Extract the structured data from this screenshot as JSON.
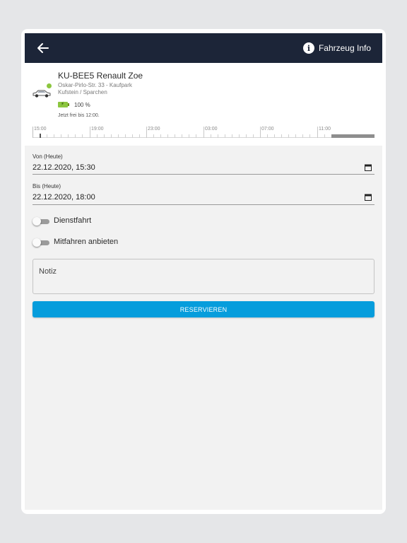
{
  "colors": {
    "appbar": "#1c2538",
    "accent": "#069ddc",
    "status_available": "#8cc63f",
    "battery": "#8cc63f"
  },
  "header": {
    "back_icon": "arrow-left-icon",
    "info_icon": "info-icon",
    "info_label": "Fahrzeug Info"
  },
  "vehicle": {
    "title": "KU-BEE5 Renault Zoe",
    "address_line1": "Oskar-Pirlo-Str. 33 - Kaufpark",
    "address_line2": "Kufstein / Sparchen",
    "battery_percent": "100 %",
    "availability": "Jetzt frei bis 12:00.",
    "car_icon": "car-icon"
  },
  "timeline": {
    "labels": [
      "15:00",
      "19:00",
      "23:00",
      "03:00",
      "07:00",
      "11:00"
    ]
  },
  "form": {
    "from_label": "Von (Heute)",
    "from_value": "22.12.2020, 15:30",
    "to_label": "Bis (Heute)",
    "to_value": "22.12.2020, 18:00",
    "calendar_icon": "calendar-icon",
    "toggle_business": "Dienstfahrt",
    "toggle_rideshare": "Mitfahren anbieten",
    "note_placeholder": "Notiz",
    "reserve_button": "RESERVIEREN"
  }
}
